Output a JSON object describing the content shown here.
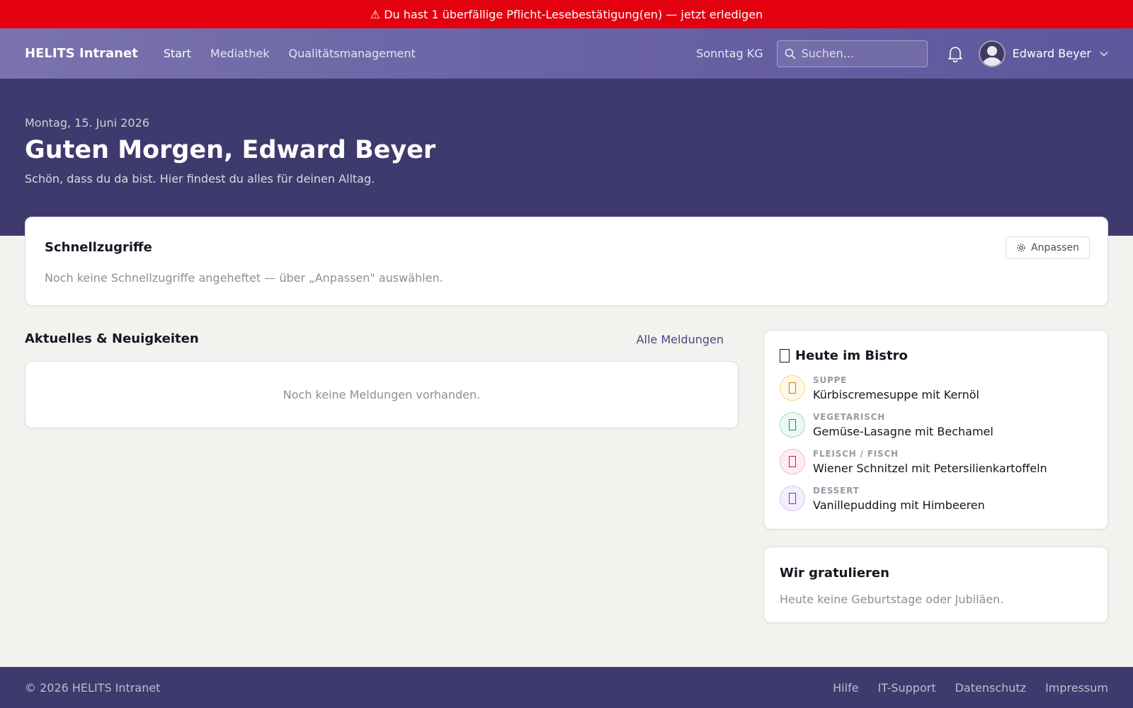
{
  "alert": {
    "text": "⚠ Du hast 1 überfällige Pflicht-Lesebestätigung(en) — jetzt erledigen"
  },
  "nav": {
    "brand": "HELITS Intranet",
    "links": [
      {
        "label": "Start",
        "active": true
      },
      {
        "label": "Mediathek",
        "active": false
      },
      {
        "label": "Qualitätsmanagement",
        "active": false
      }
    ],
    "org": "Sonntag KG",
    "search_placeholder": "Suchen...",
    "user_name": "Edward Beyer",
    "icons": {
      "search": "search-icon",
      "notifications": "bell-icon",
      "avatar": "user-avatar",
      "menu": "chevron-down-icon"
    }
  },
  "hero": {
    "date": "Montag, 15. Juni 2026",
    "greeting": "Guten Morgen, Edward Beyer",
    "subtitle": "Schön, dass du da bist. Hier findest du alles für deinen Alltag."
  },
  "quick_access": {
    "title": "Schnellzugriffe",
    "customize_label": "Anpassen",
    "empty_text": "Noch keine Schnellzugriffe angeheftet — über „Anpassen\" auswählen."
  },
  "news": {
    "title": "Aktuelles & Neuigkeiten",
    "all_link": "Alle Meldungen",
    "empty_text": "Noch keine Meldungen vorhanden."
  },
  "bistro": {
    "title": "Heute im Bistro",
    "items": [
      {
        "category": "SUPPE",
        "dish": "Kürbiscremesuppe mit Kernöl",
        "color": "#c97a12",
        "bg": "#fff8e6",
        "border": "#f5d98a"
      },
      {
        "category": "VEGETARISCH",
        "dish": "Gemüse-Lasagne mit Bechamel",
        "color": "#1f8a5c",
        "bg": "#eafaf2",
        "border": "#9fe0c2"
      },
      {
        "category": "FLEISCH / FISCH",
        "dish": "Wiener Schnitzel mit Petersilienkartoffeln",
        "color": "#b4234b",
        "bg": "#fdeef2",
        "border": "#f2b9c9"
      },
      {
        "category": "DESSERT",
        "dish": "Vanillepudding mit Himbeeren",
        "color": "#6a3bb5",
        "bg": "#f4effc",
        "border": "#d4c4f0"
      }
    ]
  },
  "congrats": {
    "title": "Wir gratulieren",
    "empty_text": "Heute keine Geburtstage oder Jubiläen."
  },
  "footer": {
    "copyright": "© 2026 HELITS Intranet",
    "links": [
      "Hilfe",
      "IT-Support",
      "Datenschutz",
      "Impressum"
    ]
  },
  "colors": {
    "alert": "#e3000f",
    "primary_dark": "#3f3a6d",
    "nav": "#6962a4",
    "background": "#f3f2ef"
  }
}
